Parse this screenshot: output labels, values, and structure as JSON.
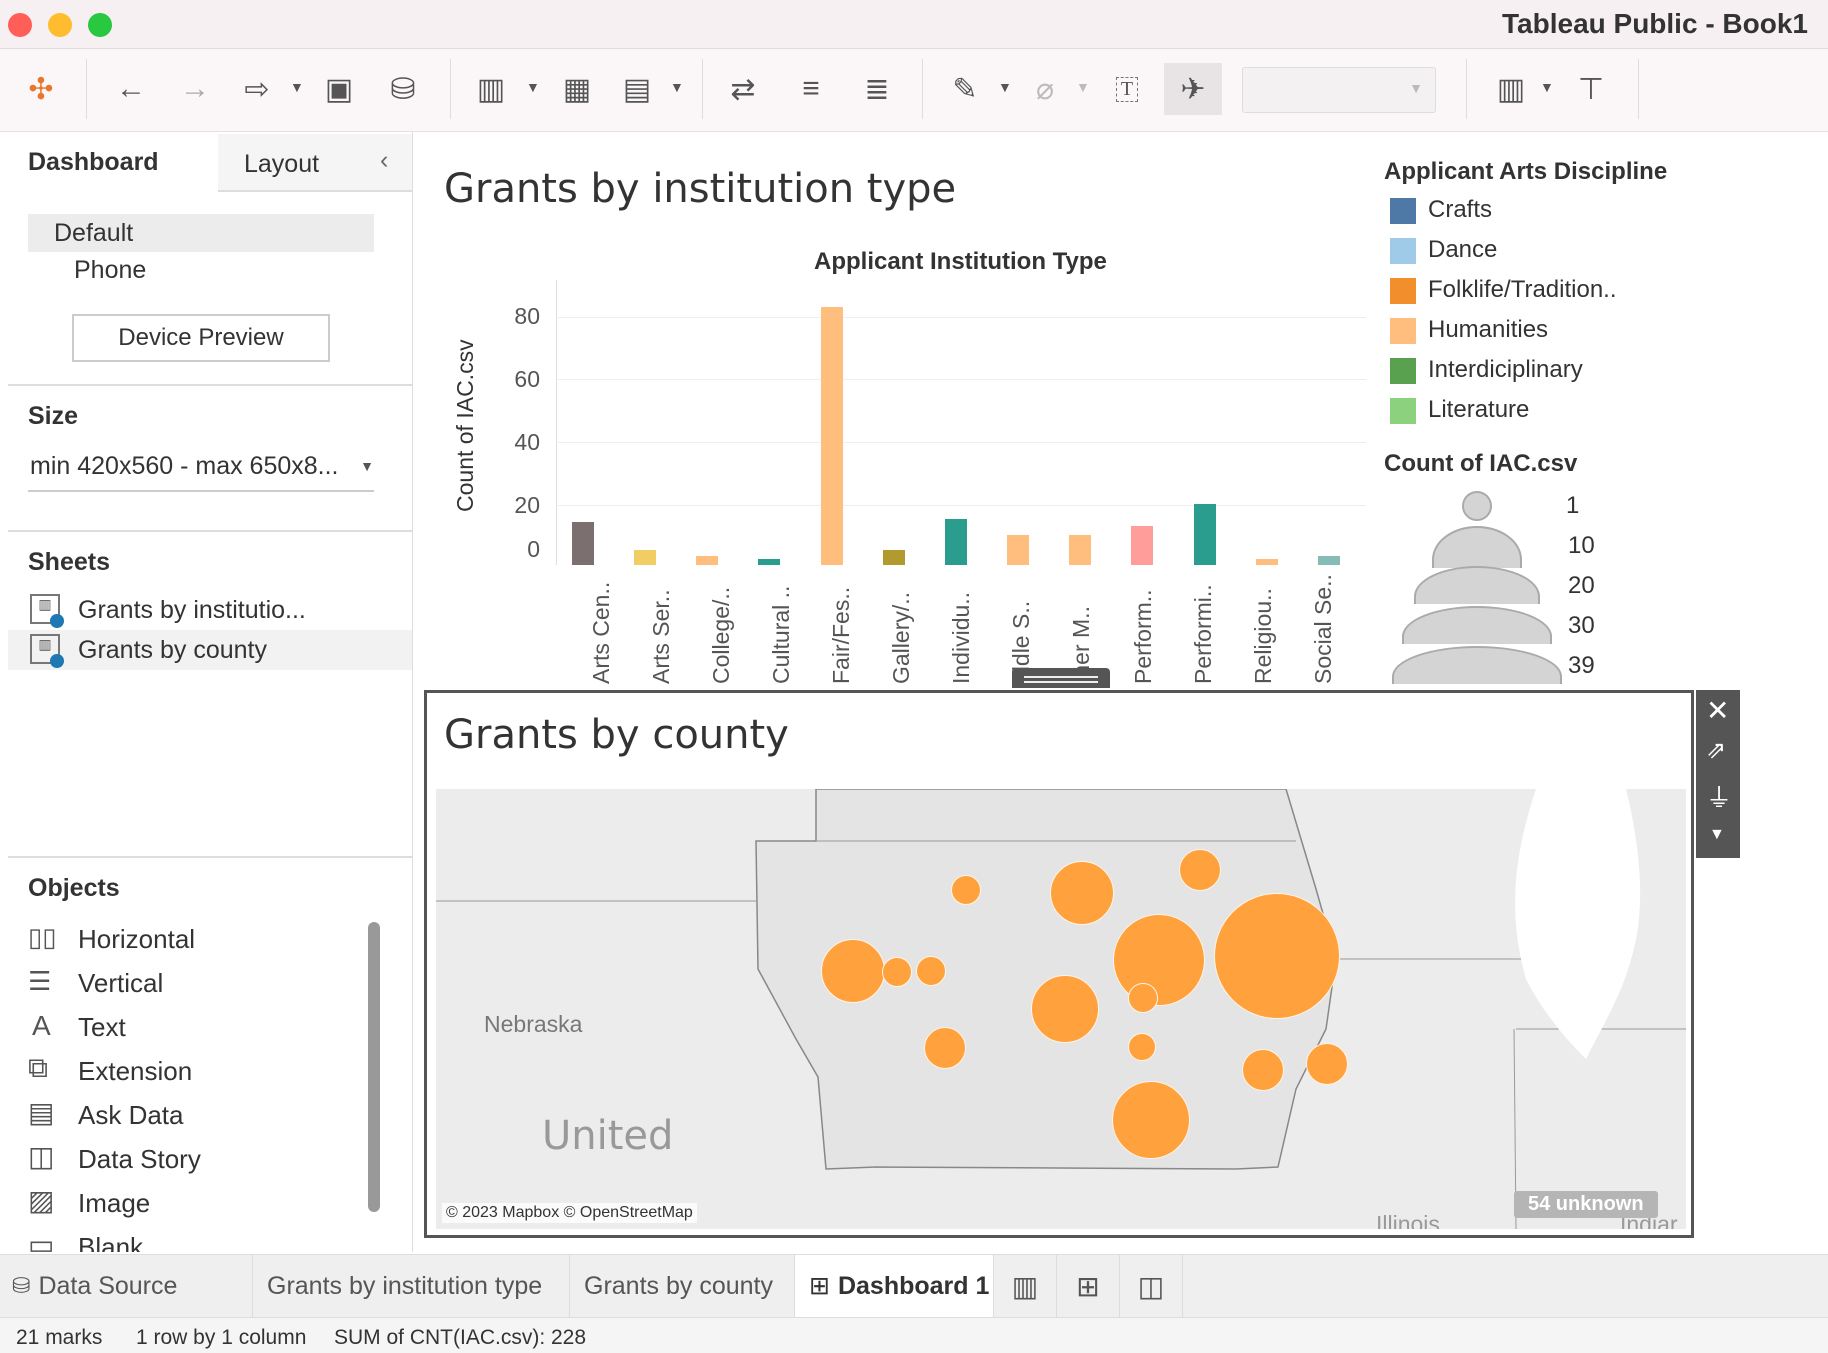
{
  "window": {
    "title": "Tableau Public - Book1"
  },
  "sidebar": {
    "tabs": [
      {
        "label": "Dashboard"
      },
      {
        "label": "Layout"
      }
    ],
    "device": {
      "options": [
        {
          "label": "Default"
        },
        {
          "label": "Phone"
        }
      ],
      "preview_button": "Device Preview"
    },
    "size": {
      "heading": "Size",
      "value": "min 420x560 - max 650x8..."
    },
    "sheets": {
      "heading": "Sheets",
      "items": [
        {
          "label": "Grants by institutio..."
        },
        {
          "label": "Grants by county"
        }
      ]
    },
    "objects": {
      "heading": "Objects",
      "items": [
        {
          "label": "Horizontal",
          "icon": "horizontal-icon"
        },
        {
          "label": "Vertical",
          "icon": "vertical-icon"
        },
        {
          "label": "Text",
          "icon": "text-icon"
        },
        {
          "label": "Extension",
          "icon": "extension-icon"
        },
        {
          "label": "Ask Data",
          "icon": "ask-data-icon"
        },
        {
          "label": "Data Story",
          "icon": "data-story-icon"
        },
        {
          "label": "Image",
          "icon": "image-icon"
        },
        {
          "label": "Blank",
          "icon": "blank-icon"
        }
      ]
    }
  },
  "sheet1": {
    "title": "Grants by institution type"
  },
  "sheet2": {
    "title": "Grants by county"
  },
  "legend": {
    "color_title": "Applicant Arts Discipline",
    "color_items": [
      {
        "label": "Crafts",
        "color": "#4e79a7"
      },
      {
        "label": "Dance",
        "color": "#a0cbe8"
      },
      {
        "label": "Folklife/Tradition..",
        "color": "#f28e2b"
      },
      {
        "label": "Humanities",
        "color": "#ffbe7d"
      },
      {
        "label": "Interdiciplinary",
        "color": "#59a14f"
      },
      {
        "label": "Literature",
        "color": "#8cd17d"
      }
    ],
    "size_title": "Count of IAC.csv",
    "size_items": [
      "1",
      "10",
      "20",
      "30",
      "39"
    ]
  },
  "chart_data": {
    "type": "bar",
    "title": "Applicant Institution Type",
    "ylabel": "Count of IAC.csv",
    "ylim": [
      0,
      85
    ],
    "yticks": [
      "80",
      "60",
      "40",
      "20",
      "0"
    ],
    "categories": [
      "Arts Cen..",
      "Arts Ser..",
      "College/..",
      "Cultural ..",
      "Fair/Fes..",
      "Gallery/..",
      "Individu..",
      "iddle S..",
      "ther M..",
      "Perform..",
      "Performi..",
      "Religiou..",
      "Social Se.."
    ],
    "category_totals": [
      14,
      5,
      3,
      2,
      85,
      5,
      15,
      10,
      10,
      13,
      20,
      2,
      3
    ]
  },
  "map": {
    "labels": {
      "nebraska": "Nebraska",
      "united": "United",
      "illinois": "Illinois",
      "indiana": "Indiar"
    },
    "attribution": "© 2023 Mapbox © OpenStreetMap",
    "unknown_badge": "54 unknown"
  },
  "bottom_tabs": [
    {
      "label": "Data Source"
    },
    {
      "label": "Grants by institution type"
    },
    {
      "label": "Grants by county"
    },
    {
      "label": "Dashboard 1"
    }
  ],
  "status": {
    "marks": "21 marks",
    "rows": "1 row by 1 column",
    "sum": "SUM of CNT(IAC.csv): 228"
  }
}
